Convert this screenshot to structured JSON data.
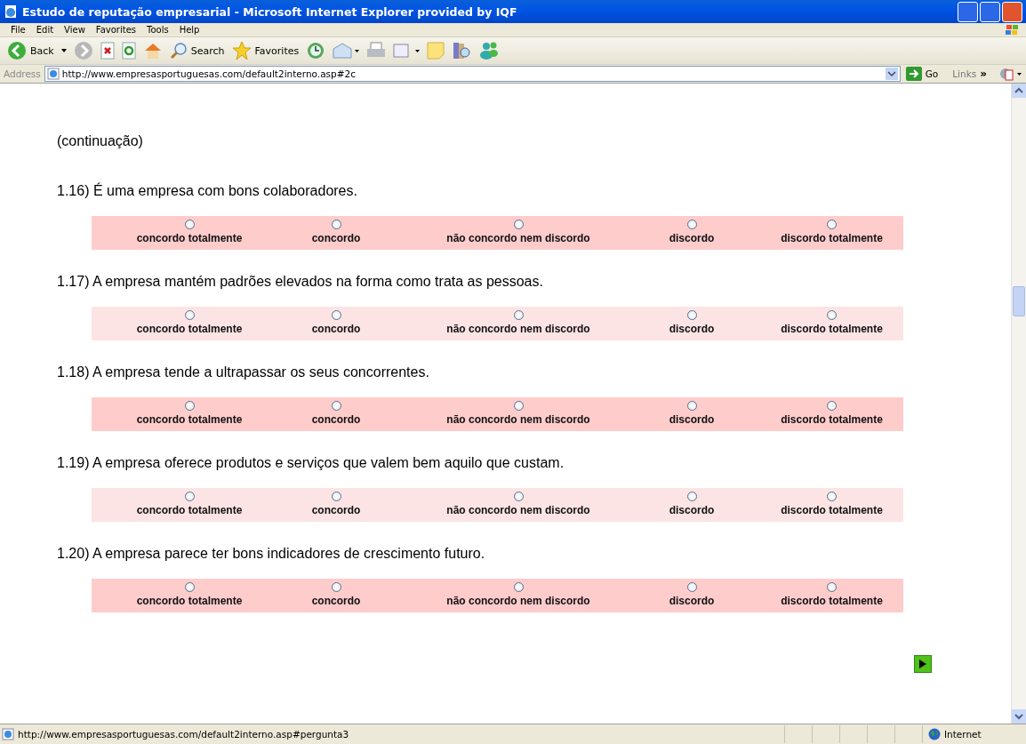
{
  "window": {
    "title": "Estudo de reputação empresarial - Microsoft Internet Explorer provided by IQF"
  },
  "menu": [
    "File",
    "Edit",
    "View",
    "Favorites",
    "Tools",
    "Help"
  ],
  "toolbar": {
    "back": "Back",
    "search": "Search",
    "favorites": "Favorites"
  },
  "address_bar": {
    "label": "Address",
    "url": "http://www.empresasportuguesas.com/default2interno.asp#2c",
    "go": "Go",
    "links": "Links",
    "links_more": "»"
  },
  "page": {
    "heading": "(continuação)",
    "questions": [
      {
        "text": "1.16) É uma empresa com bons colaboradores.",
        "color": "#ffcccc",
        "options": [
          {
            "label": "concordo totalmente",
            "selected": false
          },
          {
            "label": "concordo",
            "selected": false
          },
          {
            "label": "não concordo nem discordo",
            "selected": false
          },
          {
            "label": "discordo",
            "selected": false
          },
          {
            "label": "discordo totalmente",
            "selected": false
          }
        ]
      },
      {
        "text": "1.17) A empresa mantém padrões elevados na forma como trata as pessoas.",
        "color": "#fde4e4",
        "options": [
          {
            "label": "concordo totalmente",
            "selected": false
          },
          {
            "label": "concordo",
            "selected": false
          },
          {
            "label": "não concordo nem discordo",
            "selected": false
          },
          {
            "label": "discordo",
            "selected": false
          },
          {
            "label": "discordo totalmente",
            "selected": false
          }
        ]
      },
      {
        "text": "1.18) A empresa tende a ultrapassar os seus concorrentes.",
        "color": "#ffcccc",
        "options": [
          {
            "label": "concordo totalmente",
            "selected": false
          },
          {
            "label": "concordo",
            "selected": false
          },
          {
            "label": "não concordo nem discordo",
            "selected": false
          },
          {
            "label": "discordo",
            "selected": false
          },
          {
            "label": "discordo totalmente",
            "selected": false
          }
        ]
      },
      {
        "text": "1.19) A empresa oferece produtos e serviços que valem bem aquilo que custam.",
        "color": "#fde4e4",
        "options": [
          {
            "label": "concordo totalmente",
            "selected": false
          },
          {
            "label": "concordo",
            "selected": false
          },
          {
            "label": "não concordo nem discordo",
            "selected": false
          },
          {
            "label": "discordo",
            "selected": false
          },
          {
            "label": "discordo totalmente",
            "selected": false
          }
        ]
      },
      {
        "text": "1.20) A empresa parece ter bons indicadores de crescimento futuro.",
        "color": "#ffcccc",
        "options": [
          {
            "label": "concordo totalmente",
            "selected": false
          },
          {
            "label": "concordo",
            "selected": false
          },
          {
            "label": "não concordo nem discordo",
            "selected": false
          },
          {
            "label": "discordo",
            "selected": false
          },
          {
            "label": "discordo totalmente",
            "selected": false
          }
        ]
      }
    ]
  },
  "status_bar": {
    "url": "http://www.empresasportuguesas.com/default2interno.asp#pergunta3",
    "zone": "Internet"
  }
}
